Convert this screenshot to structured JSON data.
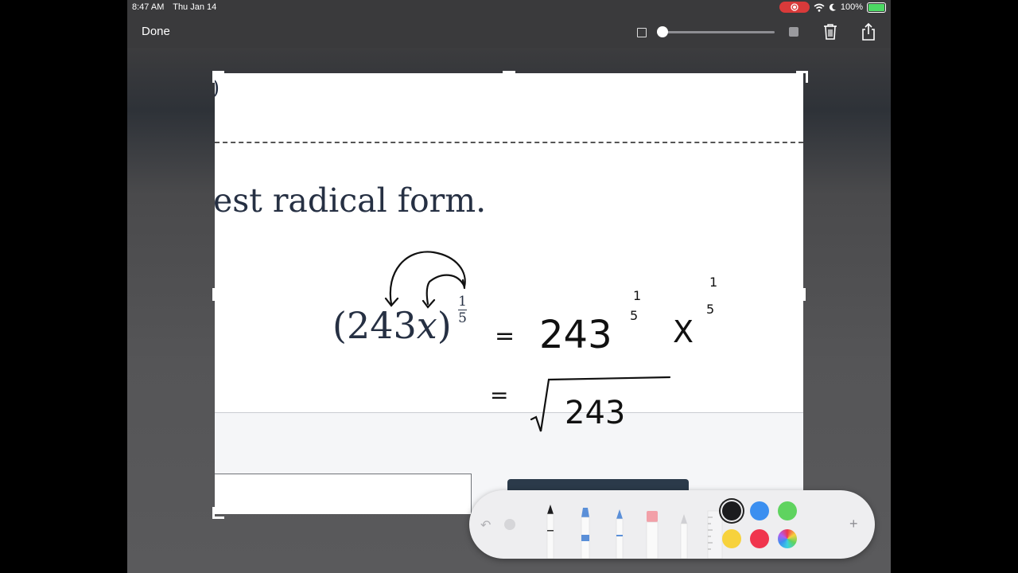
{
  "status": {
    "time": "8:47 AM",
    "date": "Thu Jan 14",
    "battery": "100%"
  },
  "toolbar_top": {
    "done_label": "Done"
  },
  "page": {
    "edge_char": ")",
    "instruction": "est radical form.",
    "formula_open": "(243",
    "formula_var": "x",
    "formula_close": ")",
    "exponent_num": "1",
    "exponent_den": "5"
  },
  "handwriting": {
    "line1_eq": "=",
    "line1_base": "243",
    "line1_exp_num": "1",
    "line1_exp_den": "5",
    "line1_var": "X",
    "line1_var_exp_num": "1",
    "line1_var_exp_den": "5",
    "line2_eq": "=",
    "line2_radicand": "243"
  },
  "markup_toolbar": {
    "tools": [
      "pen",
      "marker",
      "pencil",
      "eraser",
      "lasso",
      "ruler"
    ],
    "colors": [
      "#1c1c1e",
      "#3b8ff0",
      "#5fd35f",
      "#f7d23c",
      "#f0354e",
      "color-wheel"
    ],
    "selected_color": "#1c1c1e"
  },
  "icons": [
    "record-icon",
    "wifi-icon",
    "moon-icon",
    "battery-icon",
    "trash-icon",
    "share-icon",
    "undo-icon",
    "redo-icon",
    "plus-icon"
  ]
}
